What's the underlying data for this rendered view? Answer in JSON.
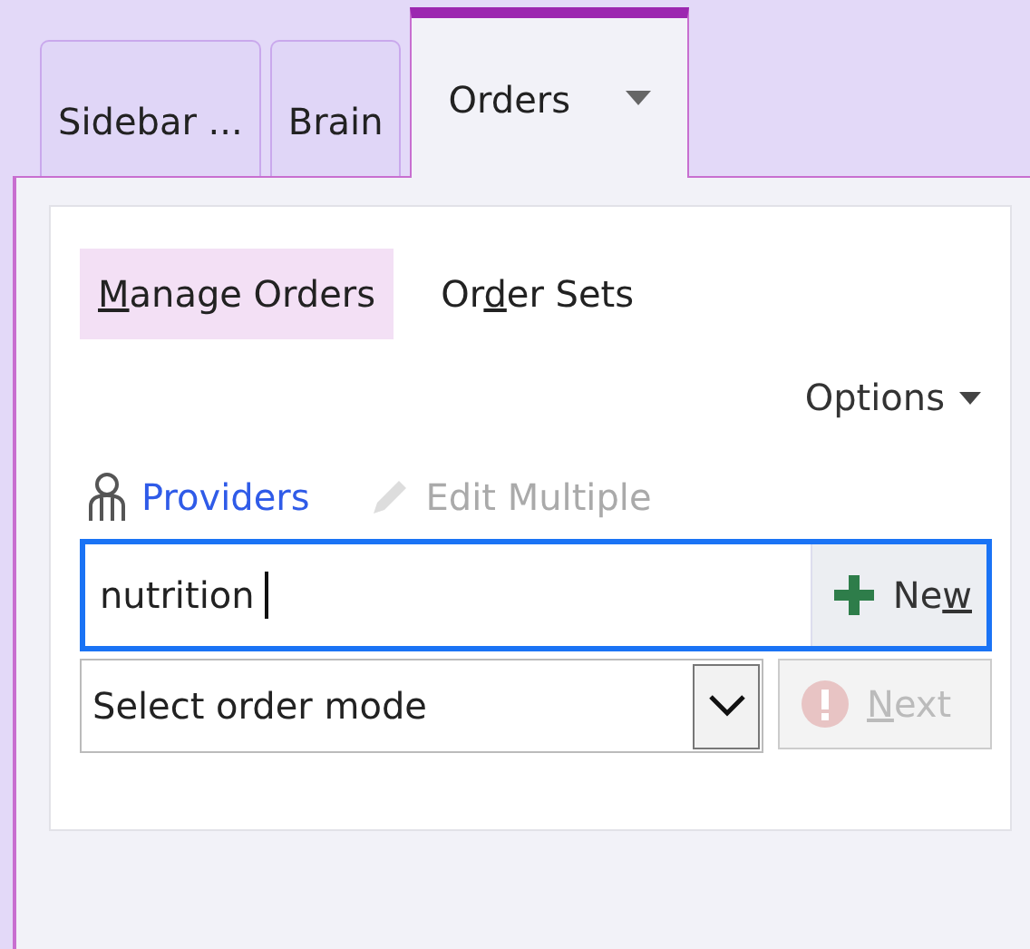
{
  "tabs": [
    {
      "label": "Sidebar ...",
      "selected": false,
      "dropdown": false
    },
    {
      "label": "Brain",
      "selected": false,
      "dropdown": false
    },
    {
      "label": "Orders",
      "selected": true,
      "dropdown": true
    }
  ],
  "subtabs": [
    {
      "label": {
        "key": "M",
        "after": "anage Orders"
      },
      "selected": true
    },
    {
      "label": {
        "before": "Or",
        "key": "d",
        "after": "er Sets"
      },
      "selected": false
    }
  ],
  "options_menu": "Options",
  "actions": [
    {
      "label": "Providers",
      "disabled": false,
      "kind": "person"
    },
    {
      "label": "Edit Multiple",
      "disabled": true,
      "kind": "pencil"
    }
  ],
  "search": {
    "value": "nutrition",
    "focused": true
  },
  "new_button": {
    "label": {
      "before": "Ne",
      "key": "w"
    },
    "disabled": false
  },
  "order_mode": {
    "value": "Select order mode"
  },
  "next_button": {
    "label": {
      "key": "N",
      "after": "ext"
    },
    "disabled": true
  }
}
